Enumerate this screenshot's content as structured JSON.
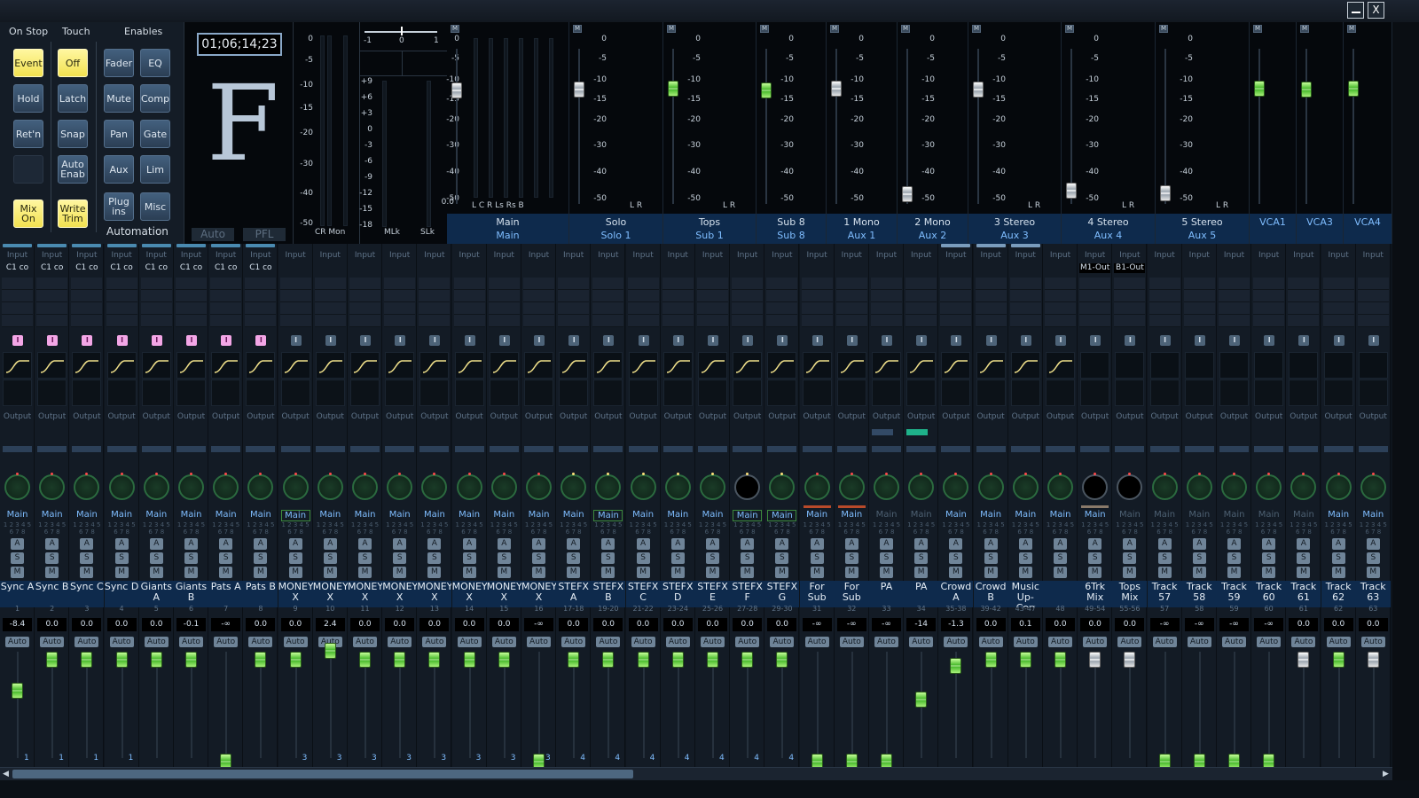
{
  "window": {
    "minimize": "",
    "close": "X"
  },
  "automation": {
    "headers": {
      "on_stop": "On Stop",
      "touch": "Touch",
      "enables": "Enables"
    },
    "on_stop": [
      "Event",
      "Hold",
      "Ret'n",
      "",
      "Mix On"
    ],
    "touch": [
      "Off",
      "Latch",
      "Snap",
      "Auto Enab",
      "Write Trim"
    ],
    "enables_a": [
      "Fader",
      "Mute",
      "Pan",
      "Aux",
      "Plug ins"
    ],
    "enables_b": [
      "EQ",
      "Comp",
      "Gate",
      "Lim",
      "Misc"
    ],
    "label": "Automation"
  },
  "scene": {
    "timecode": "01;06;14;23",
    "letter": "F",
    "auto": "Auto",
    "pfl": "PFL"
  },
  "meters": {
    "cr_scale": [
      "0",
      "-5",
      "-10",
      "-15",
      "-20",
      "-30",
      "-40",
      "-50"
    ],
    "cr_label": "CR Mon",
    "ml_top": [
      "-1",
      "0",
      "1"
    ],
    "ml_scale": [
      "+9",
      "+6",
      "+3",
      "0",
      "-3",
      "-6",
      "-9",
      "-12",
      "-15",
      "-18"
    ],
    "ml_label": "MLk",
    "sl_label": "SLk"
  },
  "buses": [
    {
      "name": "Main",
      "sub": "Main",
      "chan": "L C R Ls Rs B",
      "scale_first": "0.0"
    },
    {
      "name": "Solo",
      "sub": "Solo 1",
      "chan": "L R"
    },
    {
      "name": "Tops",
      "sub": "Sub 1",
      "chan": "L R"
    },
    {
      "name": "Sub 8",
      "sub": "Sub 8",
      "chan": ""
    },
    {
      "name": "1 Mono",
      "sub": "Aux 1",
      "chan": ""
    },
    {
      "name": "2 Mono",
      "sub": "Aux 2",
      "chan": ""
    },
    {
      "name": "3 Stereo",
      "sub": "Aux 3",
      "chan": "L R"
    },
    {
      "name": "4 Stereo",
      "sub": "Aux 4",
      "chan": "L R"
    },
    {
      "name": "5 Stereo",
      "sub": "Aux 5",
      "chan": "L R"
    },
    {
      "name": "",
      "sub": "VCA1",
      "chan": ""
    },
    {
      "name": "",
      "sub": "VCA3",
      "chan": ""
    },
    {
      "name": "",
      "sub": "VCA4",
      "chan": ""
    }
  ],
  "bus_scale": [
    "0",
    "-5",
    "-10",
    "-15",
    "-20",
    "-30",
    "-40",
    "-50"
  ],
  "strip_labels": {
    "input": "Input",
    "output": "Output",
    "auto": "Auto",
    "a": "A",
    "s": "S",
    "m": "M",
    "insert": "I",
    "nums": "1 2 3 4 5 6 7 8"
  },
  "strips": [
    {
      "name": "Sync A",
      "num": "1",
      "gain": "-8.4",
      "dest": "Main",
      "ins": "C1 co",
      "vca": "1"
    },
    {
      "name": "Sync B",
      "num": "2",
      "gain": "0.0",
      "dest": "Main",
      "ins": "C1 co",
      "vca": "1"
    },
    {
      "name": "Sync C",
      "num": "3",
      "gain": "0.0",
      "dest": "Main",
      "ins": "C1 co",
      "vca": "1"
    },
    {
      "name": "Sync D",
      "num": "4",
      "gain": "0.0",
      "dest": "Main",
      "ins": "C1 co",
      "vca": "1"
    },
    {
      "name": "Giants A",
      "num": "5",
      "gain": "0.0",
      "dest": "Main",
      "ins": "C1 co",
      "vca": ""
    },
    {
      "name": "Giants B",
      "num": "6",
      "gain": "-0.1",
      "dest": "Main",
      "ins": "C1 co",
      "vca": ""
    },
    {
      "name": "Pats A",
      "num": "7",
      "gain": "-∞",
      "dest": "Main",
      "ins": "C1 co",
      "vca": ""
    },
    {
      "name": "Pats B",
      "num": "8",
      "gain": "0.0",
      "dest": "Main",
      "ins": "C1 co",
      "vca": ""
    },
    {
      "name": "MONEY X",
      "num": "9",
      "gain": "0.0",
      "dest": "Main",
      "ins": "",
      "vca": "3"
    },
    {
      "name": "MONEY X",
      "num": "10",
      "gain": "2.4",
      "dest": "Main",
      "ins": "",
      "vca": "3"
    },
    {
      "name": "MONEY X",
      "num": "11",
      "gain": "0.0",
      "dest": "Main",
      "ins": "",
      "vca": "3"
    },
    {
      "name": "MONEY X",
      "num": "12",
      "gain": "0.0",
      "dest": "Main",
      "ins": "",
      "vca": "3"
    },
    {
      "name": "MONEY X",
      "num": "13",
      "gain": "0.0",
      "dest": "Main",
      "ins": "",
      "vca": "3"
    },
    {
      "name": "MONEY X",
      "num": "14",
      "gain": "0.0",
      "dest": "Main",
      "ins": "",
      "vca": "3"
    },
    {
      "name": "MONEY X",
      "num": "15",
      "gain": "0.0",
      "dest": "Main",
      "ins": "",
      "vca": "3"
    },
    {
      "name": "MONEY X",
      "num": "16",
      "gain": "-∞",
      "dest": "Main",
      "ins": "",
      "vca": "3"
    },
    {
      "name": "STEFX A",
      "num": "17-18",
      "gain": "0.0",
      "dest": "Main",
      "ins": "",
      "vca": "4"
    },
    {
      "name": "STEFX B",
      "num": "19-20",
      "gain": "0.0",
      "dest": "Main",
      "ins": "",
      "vca": "4"
    },
    {
      "name": "STEFX C",
      "num": "21-22",
      "gain": "0.0",
      "dest": "Main",
      "ins": "",
      "vca": "4"
    },
    {
      "name": "STEFX D",
      "num": "23-24",
      "gain": "0.0",
      "dest": "Main",
      "ins": "",
      "vca": "4"
    },
    {
      "name": "STEFX E",
      "num": "25-26",
      "gain": "0.0",
      "dest": "Main",
      "ins": "",
      "vca": "4"
    },
    {
      "name": "STEFX F",
      "num": "27-28",
      "gain": "0.0",
      "dest": "Main",
      "ins": "",
      "vca": "4"
    },
    {
      "name": "STEFX G",
      "num": "29-30",
      "gain": "0.0",
      "dest": "Main",
      "ins": "",
      "vca": "4"
    },
    {
      "name": "For Sub",
      "num": "31",
      "gain": "-∞",
      "dest": "Main",
      "ins": "",
      "vca": ""
    },
    {
      "name": "For Sub",
      "num": "32",
      "gain": "-∞",
      "dest": "Main",
      "ins": "",
      "vca": ""
    },
    {
      "name": "PA",
      "num": "33",
      "gain": "-∞",
      "dest": "Main",
      "ins": "",
      "vca": ""
    },
    {
      "name": "PA",
      "num": "34",
      "gain": "-14",
      "dest": "Main",
      "ins": "",
      "vca": ""
    },
    {
      "name": "Crowd A",
      "num": "35-38",
      "gain": "-1.3",
      "dest": "Main",
      "ins": "",
      "vca": ""
    },
    {
      "name": "Crowd B",
      "num": "39-42",
      "gain": "0.0",
      "dest": "Main",
      "ins": "",
      "vca": ""
    },
    {
      "name": "Music Up-Con",
      "num": "43-47",
      "gain": "0.1",
      "dest": "Main",
      "ins": "",
      "vca": ""
    },
    {
      "name": "",
      "num": "48",
      "gain": "0.0",
      "dest": "Main",
      "ins": "",
      "vca": ""
    },
    {
      "name": "6Trk Mix",
      "num": "49-54",
      "gain": "0.0",
      "dest": "Main",
      "ins": "M1-Out",
      "vca": ""
    },
    {
      "name": "Tops Mix",
      "num": "55-56",
      "gain": "0.0",
      "dest": "Main",
      "ins": "B1-Out",
      "vca": ""
    },
    {
      "name": "Track 57",
      "num": "57",
      "gain": "-∞",
      "dest": "Main",
      "ins": "",
      "vca": ""
    },
    {
      "name": "Track 58",
      "num": "58",
      "gain": "-∞",
      "dest": "Main",
      "ins": "",
      "vca": ""
    },
    {
      "name": "Track 59",
      "num": "59",
      "gain": "-∞",
      "dest": "Main",
      "ins": "",
      "vca": ""
    },
    {
      "name": "Track 60",
      "num": "60",
      "gain": "-∞",
      "dest": "Main",
      "ins": "",
      "vca": ""
    },
    {
      "name": "Track 61",
      "num": "61",
      "gain": "0.0",
      "dest": "Main",
      "ins": "",
      "vca": ""
    },
    {
      "name": "Track 62",
      "num": "62",
      "gain": "0.0",
      "dest": "Main",
      "ins": "",
      "vca": ""
    },
    {
      "name": "Track 63",
      "num": "63",
      "gain": "0.0",
      "dest": "Main",
      "ins": "",
      "vca": ""
    }
  ]
}
